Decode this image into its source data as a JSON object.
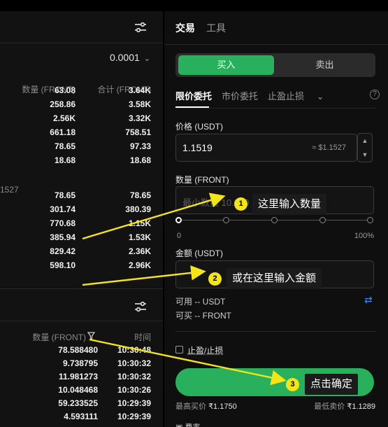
{
  "orderbook": {
    "precision": "0.0001",
    "col_amount": "数量 (FRONT)",
    "col_total": "合计 (FRONT)",
    "asks": [
      {
        "amount": "63.08",
        "total": "3.64K"
      },
      {
        "amount": "258.86",
        "total": "3.58K"
      },
      {
        "amount": "2.56K",
        "total": "3.32K"
      },
      {
        "amount": "661.18",
        "total": "758.51"
      },
      {
        "amount": "78.65",
        "total": "97.33"
      },
      {
        "amount": "18.68",
        "total": "18.68"
      }
    ],
    "mid_price": "1527",
    "bids": [
      {
        "amount": "78.65",
        "total": "78.65"
      },
      {
        "amount": "301.74",
        "total": "380.39"
      },
      {
        "amount": "770.68",
        "total": "1.15K"
      },
      {
        "amount": "385.94",
        "total": "1.53K"
      },
      {
        "amount": "829.42",
        "total": "2.36K"
      },
      {
        "amount": "598.10",
        "total": "2.96K"
      }
    ]
  },
  "trades": {
    "col_qty": "数量 (FRONT)",
    "col_time": "时间",
    "rows": [
      {
        "qty": "78.588480",
        "time": "10:30:48"
      },
      {
        "qty": "9.738795",
        "time": "10:30:32"
      },
      {
        "qty": "11.981273",
        "time": "10:30:32"
      },
      {
        "qty": "10.048468",
        "time": "10:30:26"
      },
      {
        "qty": "59.233525",
        "time": "10:29:39"
      },
      {
        "qty": "4.593111",
        "time": "10:29:39"
      }
    ]
  },
  "trade_panel": {
    "tab_trade": "交易",
    "tab_tools": "工具",
    "buy": "买入",
    "sell": "卖出",
    "order_limit": "限价委托",
    "order_market": "市价委托",
    "order_tpsl": "止盈止损",
    "price_label": "价格 (USDT)",
    "price_value": "1.1519",
    "price_approx": "≈ $1.1527",
    "qty_label": "数量 (FRONT)",
    "qty_placeholder": "最小数量 10.000",
    "slider_min": "0",
    "slider_max": "100%",
    "amount_label": "金额 (USDT)",
    "available": "可用 -- USDT",
    "can_buy": "可买 -- FRONT",
    "tpsl_checkbox": "止盈/止损",
    "max_buy_label": "最高买价",
    "max_buy_value": "₹1.1750",
    "min_sell_label": "最低卖价",
    "min_sell_value": "₹1.1289",
    "fee": "费率"
  },
  "annotations": {
    "step1_num": "1",
    "step1_text": "这里输入数量",
    "step2_num": "2",
    "step2_text": "或在这里输入金额",
    "step3_num": "3",
    "step3_text": "点击确定",
    "arrow_color": "#f3e51a"
  },
  "colors": {
    "accent_green": "#28b05c",
    "background": "#0f0f0f",
    "link_blue": "#3b8af0"
  }
}
